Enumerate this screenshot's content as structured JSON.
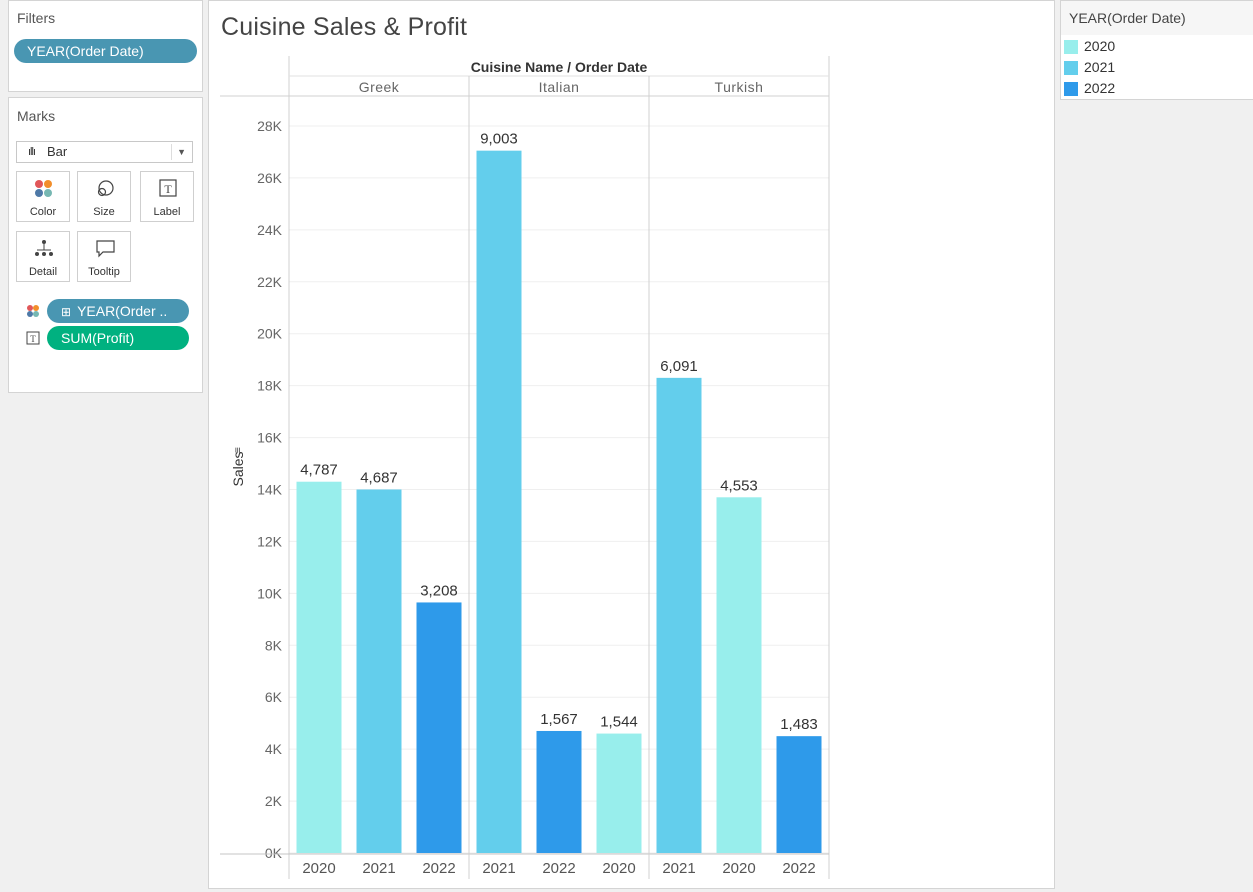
{
  "filters": {
    "title": "Filters",
    "pill": "YEAR(Order Date)"
  },
  "marks": {
    "title": "Marks",
    "mark_type": "Bar",
    "buttons": [
      "Color",
      "Size",
      "Label",
      "Detail",
      "Tooltip"
    ],
    "shelf": [
      {
        "label": "YEAR(Order ..",
        "icon": "color-icon",
        "color": "#4996b2"
      },
      {
        "label": "SUM(Profit)",
        "icon": "label-icon",
        "color": "#00b180"
      }
    ]
  },
  "sheet": {
    "title": "Cuisine Sales & Profit",
    "header": "Cuisine Name  /  Order Date"
  },
  "legend": {
    "title": "YEAR(Order Date)",
    "items": [
      {
        "label": "2020",
        "color": "#98eeec"
      },
      {
        "label": "2021",
        "color": "#63ceec"
      },
      {
        "label": "2022",
        "color": "#2e9aea"
      }
    ]
  },
  "chart_data": {
    "type": "bar",
    "title": "Cuisine Sales & Profit",
    "ylabel": "Sales",
    "ylim": [
      0,
      28000
    ],
    "yticks": [
      0,
      2000,
      4000,
      6000,
      8000,
      10000,
      12000,
      14000,
      16000,
      18000,
      20000,
      22000,
      24000,
      26000,
      28000
    ],
    "ytick_labels": [
      "0K",
      "2K",
      "4K",
      "6K",
      "8K",
      "10K",
      "12K",
      "14K",
      "16K",
      "18K",
      "20K",
      "22K",
      "24K",
      "26K",
      "28K"
    ],
    "panes": [
      {
        "name": "Greek",
        "bars": [
          {
            "year": "2020",
            "sales": 14300,
            "profit": "4,787"
          },
          {
            "year": "2021",
            "sales": 14000,
            "profit": "4,687"
          },
          {
            "year": "2022",
            "sales": 9650,
            "profit": "3,208"
          }
        ]
      },
      {
        "name": "Italian",
        "bars": [
          {
            "year": "2021",
            "sales": 27050,
            "profit": "9,003"
          },
          {
            "year": "2022",
            "sales": 4700,
            "profit": "1,567"
          },
          {
            "year": "2020",
            "sales": 4600,
            "profit": "1,544"
          }
        ]
      },
      {
        "name": "Turkish",
        "bars": [
          {
            "year": "2021",
            "sales": 18300,
            "profit": "6,091"
          },
          {
            "year": "2020",
            "sales": 13700,
            "profit": "4,553"
          },
          {
            "year": "2022",
            "sales": 4500,
            "profit": "1,483"
          }
        ]
      }
    ],
    "grid": true
  }
}
